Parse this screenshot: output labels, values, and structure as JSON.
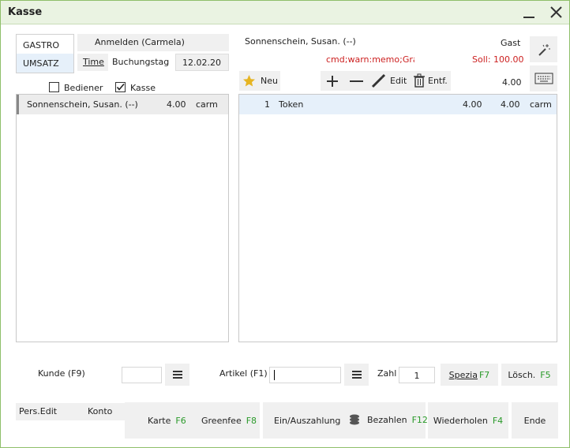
{
  "window": {
    "title": "Kasse"
  },
  "top_left": {
    "tabs": [
      "GASTRO",
      "UMSATZ"
    ],
    "login_label": "Anmelden (Carmela)",
    "time_label": "Time",
    "booking_day_label": "Buchungstag",
    "booking_day_value": "12.02.20",
    "filters": {
      "server": "Bediener",
      "register": "Kasse",
      "server_checked": false,
      "register_checked": true
    }
  },
  "open_list": [
    {
      "name": "Sonnenschein, Susan. (--)",
      "amount": "4.00",
      "user": "carm"
    }
  ],
  "guest": {
    "name": "Sonnenschein, Susan. (--)",
    "type": "Gast",
    "memo": "cmd;warn:memo;Grat",
    "due": "Soll: 100.00",
    "balance": "4.00"
  },
  "toolbar": {
    "new_label": "Neu",
    "edit_label": "Edit",
    "delete_label": "Entf."
  },
  "items": [
    {
      "qty": "1",
      "name": "Token",
      "price": "4.00",
      "total": "4.00",
      "user": "carm"
    }
  ],
  "bottom": {
    "customer_label": "Kunde (F9)",
    "article_label": "Artikel (F1)",
    "pay_label": "Zahl",
    "pay_value": "1",
    "special_label": "Spezia",
    "special_key": "F7",
    "delete_label": "Lösch.",
    "delete_key": "F5",
    "pers_edit_label": "Pers.Edit",
    "account_label": "Konto",
    "card_label": "Karte",
    "card_key": "F6",
    "greenfee_label": "Greenfee",
    "greenfee_key": "F8",
    "cash_label": "Ein/Auszahlung",
    "pay_btn_label": "Bezahlen",
    "pay_btn_key": "F12",
    "repeat_label": "Wiederholen",
    "repeat_key": "F4",
    "end_label": "Ende"
  }
}
